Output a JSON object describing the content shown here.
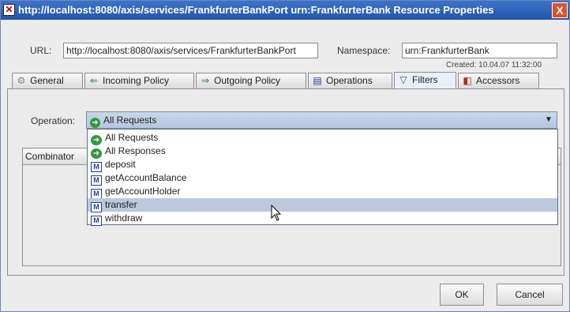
{
  "window": {
    "title": "http://localhost:8080/axis/services/FrankfurterBankPort urn:FrankfurterBank Resource Properties",
    "close_glyph": "X"
  },
  "header": {
    "url_label": "URL:",
    "url_value": "http://localhost:8080/axis/services/FrankfurterBankPort",
    "namespace_label": "Namespace:",
    "namespace_value": "urn:FrankfurterBank",
    "created": "Created: 10.04.07 11:32:00"
  },
  "tabs": [
    {
      "label": "General",
      "icon": "gear-icon"
    },
    {
      "label": "Incoming Policy",
      "icon": "incoming-icon"
    },
    {
      "label": "Outgoing Policy",
      "icon": "outgoing-icon"
    },
    {
      "label": "Operations",
      "icon": "operations-icon"
    },
    {
      "label": "Filters",
      "icon": "filter-icon"
    },
    {
      "label": "Accessors",
      "icon": "accessor-icon"
    }
  ],
  "filters": {
    "operation_label": "Operation:",
    "selected_value": "All Requests",
    "combinator_header": "Combinator",
    "options": [
      {
        "label": "All Requests",
        "icon": "request-icon"
      },
      {
        "label": "All Responses",
        "icon": "response-icon"
      },
      {
        "label": "deposit",
        "icon": "operation-icon"
      },
      {
        "label": "getAccountBalance",
        "icon": "operation-icon"
      },
      {
        "label": "getAccountHolder",
        "icon": "operation-icon"
      },
      {
        "label": "transfer",
        "icon": "operation-icon"
      },
      {
        "label": "withdraw",
        "icon": "operation-icon"
      }
    ],
    "highlighted": "transfer"
  },
  "buttons": {
    "ok": "OK",
    "cancel": "Cancel"
  },
  "colors": {
    "titlebar": "#2356a8",
    "selection": "#b9c9de",
    "combo": "#c0d0e6"
  }
}
